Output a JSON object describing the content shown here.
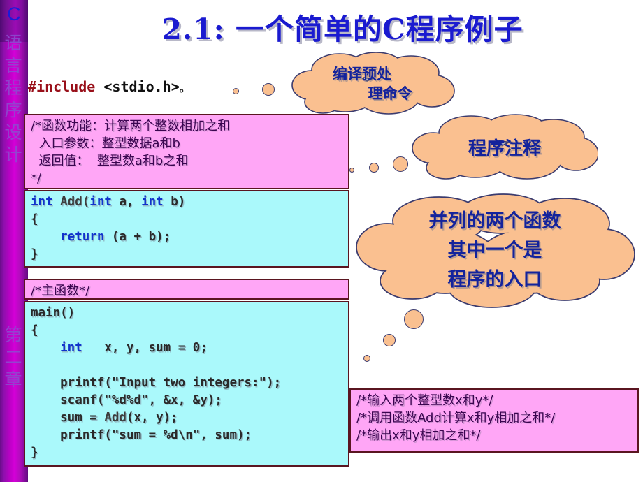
{
  "sidebar": {
    "logo": "C",
    "subject": "语言程序设计",
    "chapter": "第二章"
  },
  "slide": {
    "title": "2.1: 一个简单的C程序例子"
  },
  "include_line": {
    "directive": "#include",
    "header": " <stdio.h>",
    "trailing": "。"
  },
  "code": {
    "comment_block_1": [
      "/*函数功能：计算两个整数相加之和",
      "  入口参数：整型数据a和b",
      "  返回值：  整型数a和b之和",
      "*/"
    ],
    "add_function": {
      "line1_kw1": "int",
      "line1_fn": " Add(",
      "line1_kw2": "int",
      "line1_rest": " a, ",
      "line1_kw3": "int",
      "line1_end": " b)",
      "line2": "{",
      "line3_kw": "    return",
      "line3_rest": " (a + b);",
      "line4": "}"
    },
    "main_comment": "/*主函数*/",
    "main_function": {
      "line1": "main()",
      "line2": "{",
      "line3_kw": "    int",
      "line3_rest": "   x, y, sum = 0;",
      "line4": "",
      "line5": "    printf(\"Input two integers:\");",
      "line6": "    scanf(\"%d%d\", &x, &y);",
      "line7_a": "    sum = ",
      "line7_fn": "Add",
      "line7_b": "(x, y);",
      "line8": "    printf(\"sum = %d\\n\", sum);",
      "line9": "}"
    },
    "comment_block_2": [
      "/*输入两个整型数x和y*/",
      "/*调用函数Add计算x和y相加之和*/",
      "/*输出x和y相加之和*/"
    ]
  },
  "callouts": [
    {
      "name": "preprocessor",
      "line1": "编译预处",
      "line2": "理命令"
    },
    {
      "name": "program-comment",
      "line1": "程序注释"
    },
    {
      "name": "two-functions",
      "line1": "并列的两个函数",
      "line2": "其中一个是",
      "line3": "程序的入口"
    }
  ],
  "colors": {
    "title": "#1a1ad0",
    "sidebar_magenta": "#c000c8",
    "comment_box": "#ffa6f6",
    "code_box": "#aaf9fb",
    "cloud_fill": "#fac090",
    "cloud_stroke": "#3b3b6e",
    "keyword": "#1133cc",
    "directive": "#99101a"
  }
}
